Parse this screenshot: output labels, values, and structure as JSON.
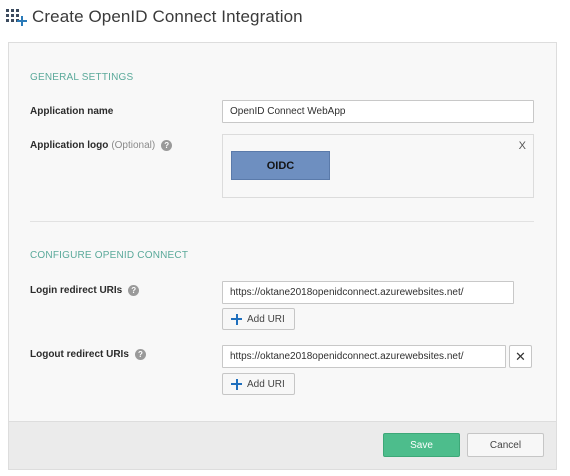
{
  "header": {
    "icon": "apps-grid-add-icon",
    "title": "Create OpenID Connect Integration"
  },
  "general": {
    "heading": "GENERAL SETTINGS",
    "app_name_label": "Application name",
    "app_name_value": "OpenID Connect WebApp",
    "app_logo_label": "Application logo",
    "app_logo_optional": "(Optional)",
    "logo_text": "OIDC",
    "logo_remove": "X",
    "help_glyph": "?"
  },
  "oidc": {
    "heading": "CONFIGURE OPENID CONNECT",
    "login_label": "Login redirect URIs",
    "login_value": "https://oktane2018openidconnect.azurewebsites.net/",
    "logout_label": "Logout redirect URIs",
    "logout_value": "https://oktane2018openidconnect.azurewebsites.net/",
    "add_uri_label": "Add URI",
    "remove_glyph": "✕"
  },
  "footer": {
    "save_label": "Save",
    "cancel_label": "Cancel"
  },
  "colors": {
    "section_heading": "#5aa99a",
    "save_button": "#4dbd8c",
    "logo_background": "#6e8fc0",
    "add_icon": "#1f6fbd"
  }
}
